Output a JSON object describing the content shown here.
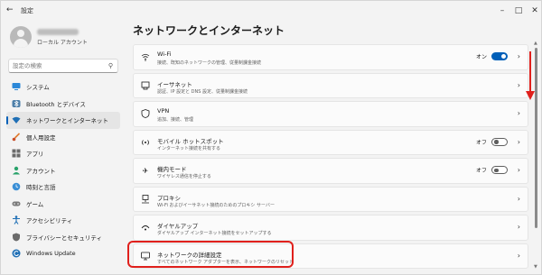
{
  "window": {
    "title": "設定"
  },
  "profile": {
    "account_type": "ローカル アカウント"
  },
  "search": {
    "placeholder": "設定の検索"
  },
  "sidebar": {
    "items": [
      {
        "label": "システム",
        "icon": "monitor-icon"
      },
      {
        "label": "Bluetooth とデバイス",
        "icon": "bluetooth-icon"
      },
      {
        "label": "ネットワークとインターネット",
        "icon": "wifi-icon",
        "active": true
      },
      {
        "label": "個人用設定",
        "icon": "brush-icon"
      },
      {
        "label": "アプリ",
        "icon": "apps-icon"
      },
      {
        "label": "アカウント",
        "icon": "person-icon"
      },
      {
        "label": "時刻と言語",
        "icon": "clock-globe-icon"
      },
      {
        "label": "ゲーム",
        "icon": "gamepad-icon"
      },
      {
        "label": "アクセシビリティ",
        "icon": "accessibility-icon"
      },
      {
        "label": "プライバシーとセキュリティ",
        "icon": "shield-icon"
      },
      {
        "label": "Windows Update",
        "icon": "update-icon"
      }
    ]
  },
  "main": {
    "title": "ネットワークとインターネット",
    "cards": [
      {
        "title": "Wi-Fi",
        "subtitle": "接続、既知のネットワークの管理、従量制課金接続",
        "icon": "wifi-icon",
        "toggle": {
          "label": "オン",
          "on": true
        }
      },
      {
        "title": "イーサネット",
        "subtitle": "認証、IP 設定と DNS 設定、従量制課金接続",
        "icon": "ethernet-icon"
      },
      {
        "title": "VPN",
        "subtitle": "追加、接続、管理",
        "icon": "vpn-shield-icon"
      },
      {
        "title": "モバイル ホットスポット",
        "subtitle": "インターネット接続を共有する",
        "icon": "hotspot-icon",
        "toggle": {
          "label": "オフ",
          "on": false
        }
      },
      {
        "title": "機内モード",
        "subtitle": "ワイヤレス通信を停止する",
        "icon": "airplane-icon",
        "toggle": {
          "label": "オフ",
          "on": false
        }
      },
      {
        "title": "プロキシ",
        "subtitle": "Wi-Fi およびイーサネット接続のためのプロキシ サーバー",
        "icon": "proxy-icon"
      },
      {
        "title": "ダイヤルアップ",
        "subtitle": "ダイヤルアップ インターネット接続をセットアップする",
        "icon": "dialup-icon"
      },
      {
        "title": "ネットワークの詳細設定",
        "subtitle": "すべてのネットワーク アダプターを表示、ネットワークのリセット",
        "icon": "network-pc-icon"
      }
    ]
  },
  "colors": {
    "accent": "#005fb8",
    "highlight": "#e0201c"
  }
}
